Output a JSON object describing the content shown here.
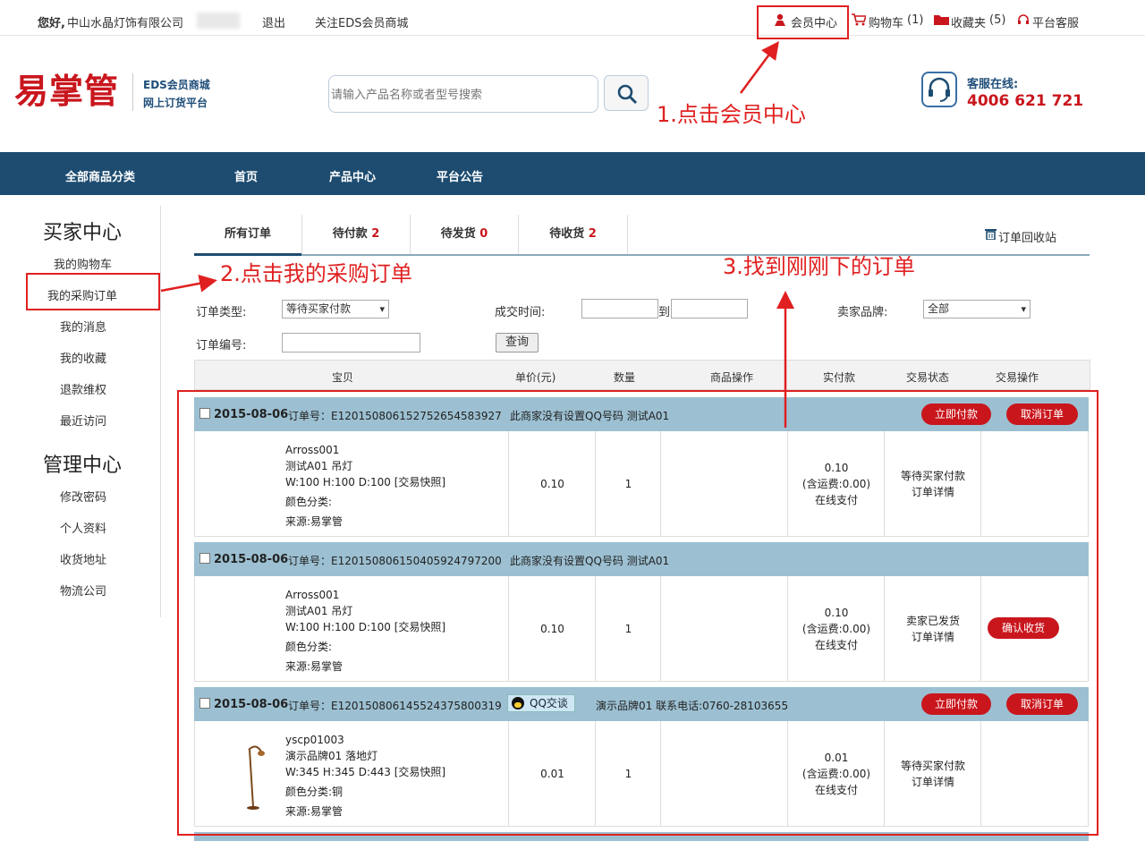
{
  "topbar": {
    "greeting": "您好,",
    "company": "中山水晶灯饰有限公司",
    "logout": "退出",
    "follow": "关注EDS会员商城",
    "member_center": "会员中心",
    "cart": "购物车",
    "cart_count": "(1)",
    "favorites": "收藏夹",
    "favorites_count": "(5)",
    "service": "平台客服"
  },
  "header": {
    "logo": "易掌管",
    "logo_sub1": "EDS会员商城",
    "logo_sub2": "网上订货平台",
    "search_placeholder": "请输入产品名称或者型号搜索",
    "hotline_label": "客服在线:",
    "hotline_number": "4006 621 721"
  },
  "nav": {
    "items": [
      "全部商品分类",
      "首页",
      "产品中心",
      "平台公告"
    ]
  },
  "sidebar": {
    "buyer_title": "买家中心",
    "buyer_items": [
      "我的购物车",
      "我的采购订单",
      "我的消息",
      "我的收藏",
      "退款维权",
      "最近访问"
    ],
    "manage_title": "管理中心",
    "manage_items": [
      "修改密码",
      "个人资料",
      "收货地址",
      "物流公司"
    ]
  },
  "tabs": [
    {
      "label": "所有订单",
      "count": ""
    },
    {
      "label": "待付款",
      "count": "2"
    },
    {
      "label": "待发货",
      "count": "0"
    },
    {
      "label": "待收货",
      "count": "2"
    }
  ],
  "recycle": "订单回收站",
  "filters": {
    "order_type_label": "订单类型:",
    "order_type_value": "等待买家付款",
    "deal_time_label": "成交时间:",
    "to": "到",
    "brand_label": "卖家品牌:",
    "brand_value": "全部",
    "order_no_label": "订单编号:",
    "query": "查询"
  },
  "table_headers": [
    "宝贝",
    "单价(元)",
    "数量",
    "商品操作",
    "实付款",
    "交易状态",
    "交易操作"
  ],
  "orders": [
    {
      "date": "2015-08-06",
      "order_no": "订单号：E1201508061527526545839​27",
      "shop": "此商家没有设置QQ号码   测试A01",
      "qq": "",
      "buttons": [
        "立即付款",
        "取消订单"
      ],
      "product": [
        "Arross001",
        "测试A01 吊灯",
        "W:100 H:100 D:100 [交易快照]",
        "颜色分类:",
        "来源:易掌管"
      ],
      "price": "0.10",
      "qty": "1",
      "paid": [
        "0.10",
        "(含运费:0.00)",
        "在线支付"
      ],
      "status": [
        "等待买家付款",
        "订单详情"
      ],
      "action": ""
    },
    {
      "date": "2015-08-06",
      "order_no": "订单号：E1201508061504059247972​00",
      "shop": "此商家没有设置QQ号码   测试A01",
      "qq": "",
      "buttons": [],
      "product": [
        "Arross001",
        "测试A01 吊灯",
        "W:100 H:100 D:100 [交易快照]",
        "颜色分类:",
        "来源:易掌管"
      ],
      "price": "0.10",
      "qty": "1",
      "paid": [
        "0.10",
        "(含运费:0.00)",
        "在线支付"
      ],
      "status": [
        "卖家已发货",
        "订单详情"
      ],
      "action": "确认收货"
    },
    {
      "date": "2015-08-06",
      "order_no": "订单号：E1201508061455243758003​19",
      "shop": "演示品牌01  联系电话:0760-28103655",
      "qq": "QQ交谈",
      "buttons": [
        "立即付款",
        "取消订单"
      ],
      "product": [
        "yscp01003",
        "演示品牌01 落地灯",
        "W:345 H:345 D:443 [交易快照]",
        "颜色分类:铜",
        "来源:易掌管"
      ],
      "price": "0.01",
      "qty": "1",
      "paid": [
        "0.01",
        "(含运费:0.00)",
        "在线支付"
      ],
      "status": [
        "等待买家付款",
        "订单详情"
      ],
      "action": ""
    }
  ],
  "annotations": {
    "step1": "1.点击会员中心",
    "step2": "2.点击我的采购订单",
    "step3": "3.找到刚刚下的订单"
  },
  "colors": {
    "brand_red": "#c9161d",
    "nav_blue": "#1d4c70",
    "order_head": "#9cc0d2",
    "annotation": "#e02020"
  }
}
